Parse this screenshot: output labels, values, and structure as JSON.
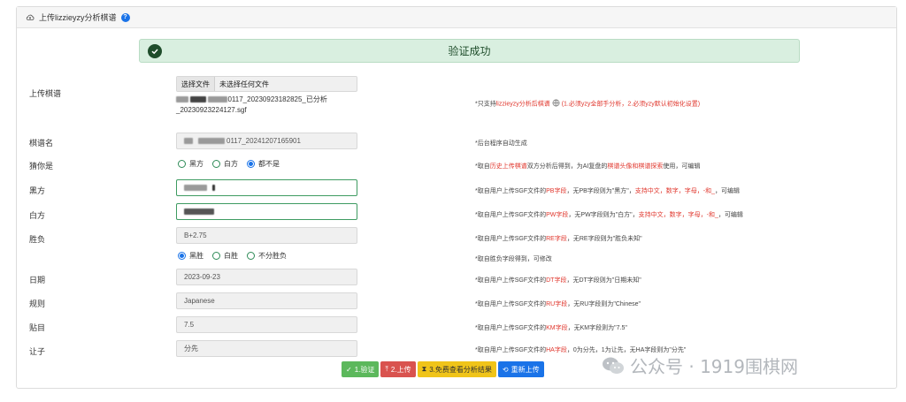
{
  "header": {
    "title": "上传lizzieyzy分析棋谱",
    "help_icon": "?"
  },
  "banner": {
    "text": "验证成功"
  },
  "upload": {
    "label": "上传棋谱",
    "choose_button": "选择文件",
    "no_file_text": "未选择任何文件",
    "filename_line1": "0117_20230923182825_已分析",
    "filename_line2": "_20230923224127.sgf",
    "note_prefix": "*只支持",
    "note_red1": "lizzieyzy分析后棋谱",
    "note_red2": "(1.必须yzy全部手分析，2.必须yzy默认初始化设置)"
  },
  "record_name": {
    "label": "棋谱名",
    "value": "0117_20241207165901",
    "note": "*后台程序自动生成"
  },
  "guess": {
    "label": "猜你是",
    "options": [
      "黑方",
      "白方",
      "都不是"
    ],
    "selected": 2,
    "note_prefix": "*取自",
    "note_red1": "历史上传棋谱",
    "note_mid": "双方分析后得到，为AI复盘的",
    "note_red2": "棋谱头像和棋谱探索",
    "note_suffix": "使用，可编辑"
  },
  "black": {
    "label": "黑方",
    "note_prefix": "*取自用户上传SGF文件的",
    "note_red1": "PB字段",
    "note_mid": "，无PB字段则为\"黑方\"，",
    "note_red2": "支持中文，数字，字母，-和_",
    "note_suffix": "，可编辑"
  },
  "white": {
    "label": "白方",
    "note_prefix": "*取自用户上传SGF文件的",
    "note_red1": "PW字段",
    "note_mid": "，无PW字段则为\"白方\"，",
    "note_red2": "支持中文，数字，字母，-和_",
    "note_suffix": "，可编辑"
  },
  "result": {
    "label": "胜负",
    "value": "B+2.75",
    "note_prefix": "*取自用户上传SGF文件的",
    "note_red": "RE字段",
    "note_suffix": "，无RE字段则为\"胜负未知\"",
    "options": [
      "黑胜",
      "白胜",
      "不分胜负"
    ],
    "selected": 0,
    "radio_note": "*取自胜负字段得到，可修改"
  },
  "date": {
    "label": "日期",
    "value": "2023-09-23",
    "note_prefix": "*取自用户上传SGF文件的",
    "note_red": "DT字段",
    "note_suffix": "，无DT字段则为\"日期未知\""
  },
  "rules": {
    "label": "规则",
    "value": "Japanese",
    "note_prefix": "*取自用户上传SGF文件的",
    "note_red": "RU字段",
    "note_suffix": "，无RU字段则为\"Chinese\""
  },
  "komi": {
    "label": "贴目",
    "value": "7.5",
    "note_prefix": "*取自用户上传SGF文件的",
    "note_red": "KM字段",
    "note_suffix": "，无KM字段则为\"7.5\""
  },
  "handicap": {
    "label": "让子",
    "value": "分先",
    "note_prefix": "*取自用户上传SGF文件的",
    "note_red": "HA字段",
    "note_suffix": "，0为分先，1为让先，无HA字段则为\"分先\""
  },
  "buttons": [
    {
      "label": "1.验证",
      "icon": "✓",
      "color": "#5cb85c"
    },
    {
      "label": "2.上传",
      "icon": "⤒",
      "color": "#d9534f"
    },
    {
      "label": "3.免费查看分析结果",
      "icon": "⧗",
      "color": "#f0c419"
    },
    {
      "label": "重新上传",
      "icon": "⟲",
      "color": "#1a73e8"
    }
  ],
  "watermark": {
    "text": "公众号 · 1919围棋网"
  },
  "colors": {
    "success": "#1f4d2b",
    "banner_bg": "#d9efe0",
    "red": "#e0362c",
    "radio": "#2e8b57"
  }
}
